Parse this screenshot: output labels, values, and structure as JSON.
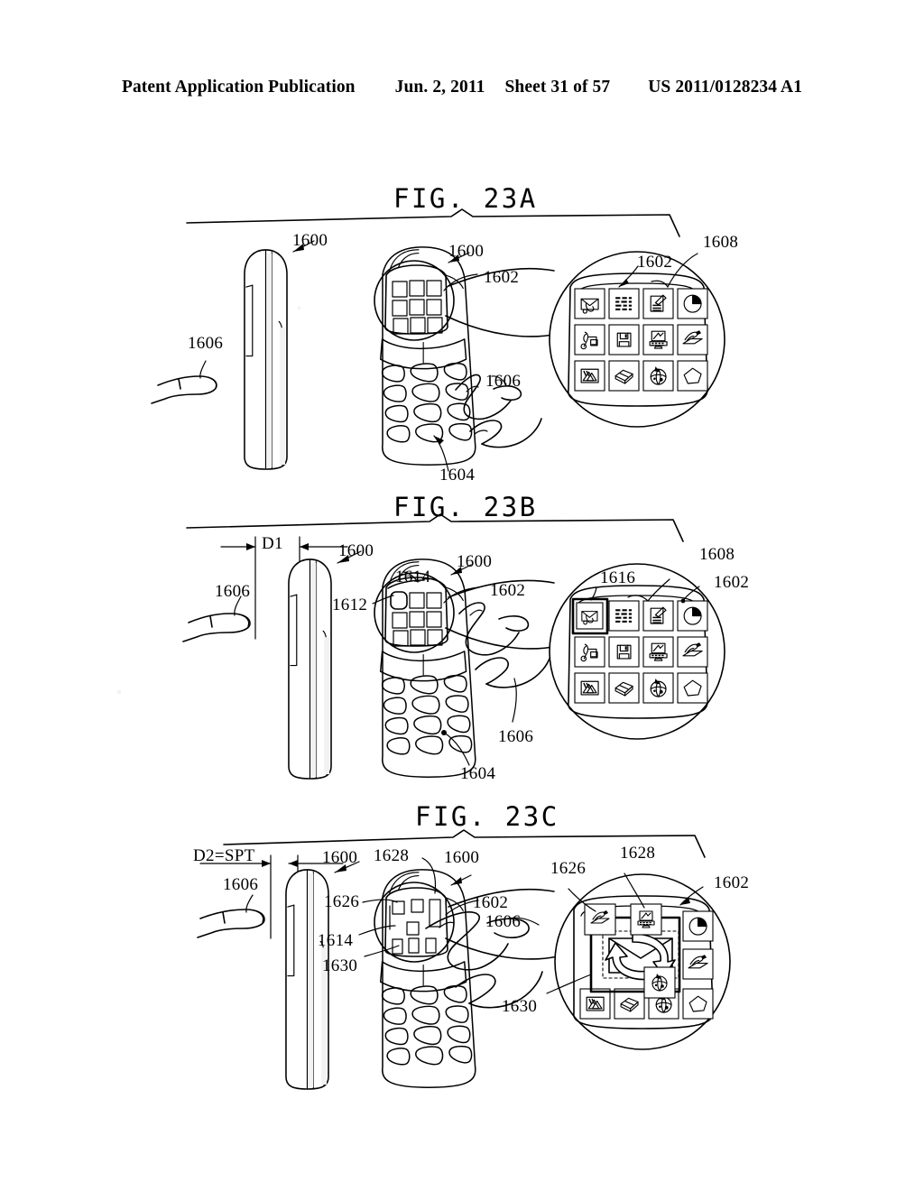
{
  "header": {
    "publication": "Patent Application Publication",
    "date": "Jun. 2, 2011",
    "sheet": "Sheet 31 of 57",
    "number": "US 2011/0128234 A1"
  },
  "figures": [
    {
      "id": "fig-23a",
      "title": "FIG.  23A",
      "labels": [
        {
          "name": "ref-1600-side",
          "text": "1600"
        },
        {
          "name": "ref-1606-left",
          "text": "1606"
        },
        {
          "name": "ref-1600-front",
          "text": "1600"
        },
        {
          "name": "ref-1602",
          "text": "1602"
        },
        {
          "name": "ref-1606-right",
          "text": "1606"
        },
        {
          "name": "ref-1604",
          "text": "1604"
        },
        {
          "name": "ref-1608",
          "text": "1608"
        },
        {
          "name": "ref-1602-detail",
          "text": "1602"
        }
      ]
    },
    {
      "id": "fig-23b",
      "title": "FIG.  23B",
      "labels": [
        {
          "name": "ref-d1",
          "text": "D1"
        },
        {
          "name": "ref-1606-left",
          "text": "1606"
        },
        {
          "name": "ref-1600-side",
          "text": "1600"
        },
        {
          "name": "ref-1612",
          "text": "1612"
        },
        {
          "name": "ref-1614",
          "text": "1614"
        },
        {
          "name": "ref-1600-front",
          "text": "1600"
        },
        {
          "name": "ref-1602",
          "text": "1602"
        },
        {
          "name": "ref-1606-right",
          "text": "1606"
        },
        {
          "name": "ref-1604",
          "text": "1604"
        },
        {
          "name": "ref-1608",
          "text": "1608"
        },
        {
          "name": "ref-1616",
          "text": "1616"
        },
        {
          "name": "ref-1602-detail",
          "text": "1602"
        }
      ]
    },
    {
      "id": "fig-23c",
      "title": "FIG.  23C",
      "labels": [
        {
          "name": "ref-d2",
          "text": "D2=SPT"
        },
        {
          "name": "ref-1606-left",
          "text": "1606"
        },
        {
          "name": "ref-1600-side",
          "text": "1600"
        },
        {
          "name": "ref-1626",
          "text": "1626"
        },
        {
          "name": "ref-1614",
          "text": "1614"
        },
        {
          "name": "ref-1630",
          "text": "1630"
        },
        {
          "name": "ref-1628",
          "text": "1628"
        },
        {
          "name": "ref-1600-front",
          "text": "1600"
        },
        {
          "name": "ref-1602",
          "text": "1602"
        },
        {
          "name": "ref-1606-right",
          "text": "1606"
        },
        {
          "name": "ref-1630-right",
          "text": "1630"
        },
        {
          "name": "ref-1626-detail",
          "text": "1626"
        },
        {
          "name": "ref-1628-detail",
          "text": "1628"
        },
        {
          "name": "ref-1602-detail",
          "text": "1602"
        }
      ]
    }
  ],
  "icon_grid": {
    "rows": 3,
    "cols": 4,
    "icons": [
      "envelope-icon",
      "list-icon",
      "notepad-icon",
      "clock-pie-icon",
      "music-note-icon",
      "floppy-disk-icon",
      "computer-icon",
      "hand-write-icon",
      "picture-icon",
      "box-icon",
      "globe-icon",
      "pentagon-icon"
    ]
  }
}
